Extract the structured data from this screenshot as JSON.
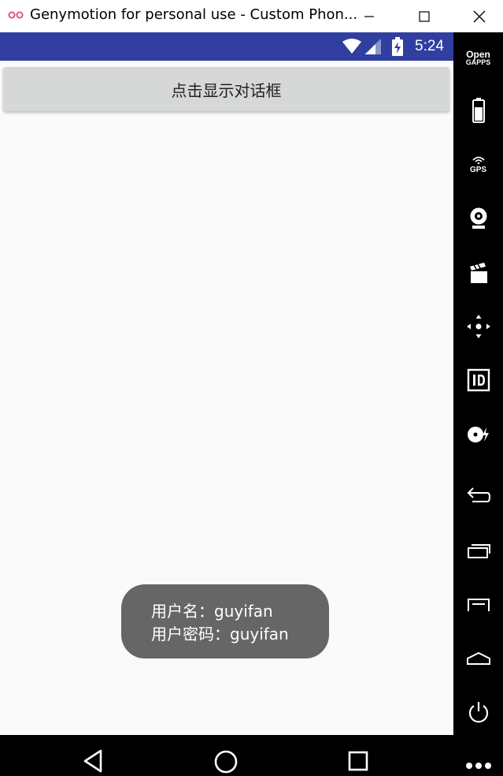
{
  "window": {
    "title": "Genymotion for personal use - Custom Phon..."
  },
  "status_bar": {
    "time": "5:24",
    "color": "#303f9f"
  },
  "main": {
    "show_dialog_button": "点击显示对话框"
  },
  "toast": {
    "line1": "用户名：guyifan",
    "line2": "用户密码：guyifan"
  },
  "sidebar": {
    "opengapps_line1": "Open",
    "opengapps_line2": "GAPPS",
    "gps_label": "GPS",
    "items": [
      "opengapps-icon",
      "battery-icon",
      "gps-icon",
      "webcam-icon",
      "media-icon",
      "dpad-icon",
      "device-id-icon",
      "disk-io-icon",
      "back-icon",
      "recent-apps-icon",
      "menu-icon",
      "home-icon",
      "power-icon",
      "more-icon"
    ]
  },
  "navbar": {
    "items": [
      "back-triangle-icon",
      "home-circle-icon",
      "recents-square-icon"
    ]
  }
}
